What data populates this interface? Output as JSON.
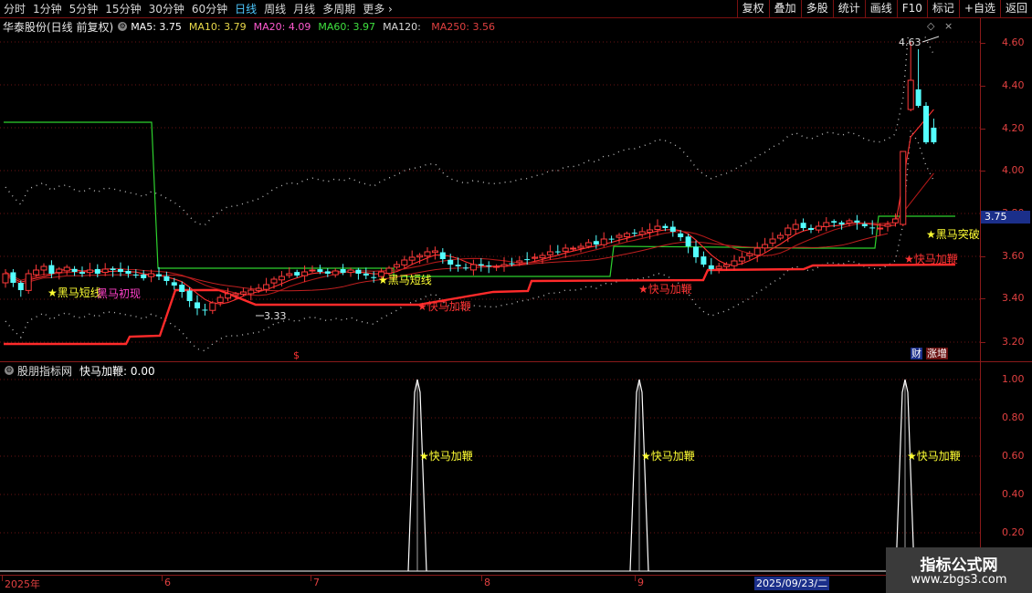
{
  "toolbar": {
    "periods": [
      "分时",
      "1分钟",
      "5分钟",
      "15分钟",
      "30分钟",
      "60分钟",
      "日线",
      "周线",
      "月线",
      "多周期",
      "更多 ›"
    ],
    "active_period": "日线",
    "tools": [
      "复权",
      "叠加",
      "多股",
      "统计",
      "画线",
      "F10",
      "标记",
      "+自选",
      "返回"
    ]
  },
  "stock": {
    "title": "华泰股份(日线 前复权)"
  },
  "ma": [
    {
      "label": "MA5: 3.75",
      "color": "#ffffff"
    },
    {
      "label": "MA10: 3.79",
      "color": "#e8d84a"
    },
    {
      "label": "MA20: 4.09",
      "color": "#ff5ad0"
    },
    {
      "label": "MA60: 3.97",
      "color": "#3fe03f"
    },
    {
      "label": "MA120: ",
      "color": "#d8d8d8"
    },
    {
      "label": "MA250: 3.56",
      "color": "#e04040"
    }
  ],
  "price_axis": {
    "labels": [
      "4.60",
      "4.40",
      "4.20",
      "4.00",
      "3.80",
      "3.60",
      "3.40",
      "3.20"
    ],
    "current": "3.75"
  },
  "annotations": {
    "high": "4.63",
    "low": "3.33",
    "heima_short_1": "★黑马短线",
    "heima_first": "黑马初现",
    "heima_short_2": "★黑马短线",
    "kuaima_1": "★快马加鞭",
    "kuaima_2": "★快马加鞭",
    "kuaima_3": "★快马加鞭",
    "heima_break": "★黑马突破",
    "dollar": "$"
  },
  "badges": {
    "cai": "财",
    "zeng": "涨增"
  },
  "indicator": {
    "name": "股朋指标网",
    "title": "快马加鞭: 0.00",
    "axis": [
      "1.00",
      "0.80",
      "0.60",
      "0.40",
      "0.20"
    ],
    "signal_label": "★快马加鞭"
  },
  "time_axis": {
    "labels": [
      "2025年",
      "6",
      "7",
      "8",
      "9"
    ],
    "selected_date": "2025/09/23/二"
  },
  "watermark": {
    "line1": "指标公式网",
    "line2": "www.zbgs3.com"
  }
}
